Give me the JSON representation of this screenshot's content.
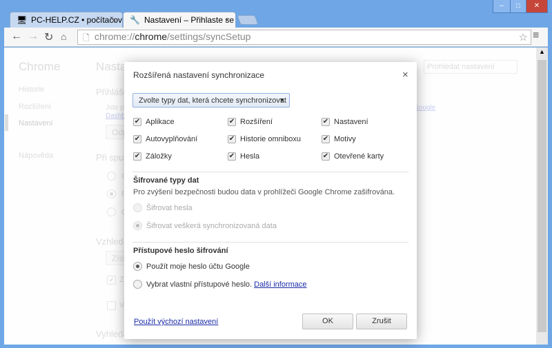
{
  "window": {
    "minimize": "–",
    "maximize": "□",
    "close": "✕"
  },
  "tabs": [
    {
      "title": "PC-HELP.CZ • počítačové",
      "icon": "computer-icon",
      "active": false
    },
    {
      "title": "Nastavení – Přihlaste se pc",
      "icon": "wrench-icon",
      "active": true
    }
  ],
  "toolbar": {
    "url_prefix": "chrome://",
    "url_host": "chrome",
    "url_path": "/settings/syncSetup"
  },
  "background": {
    "brand": "Chrome",
    "sidebar": [
      "Historie",
      "Rozšíření",
      "Nastavení",
      "Nápověda"
    ],
    "heading": "Nastavení",
    "search_placeholder": "Prohledat nastavení",
    "signin": "Přihlášení",
    "signin_text": "Jste p",
    "dashboard_link": "Dashb",
    "google_link": "Google",
    "disconnect_button": "Odp",
    "startup": "Při spuštění",
    "startup_opts": [
      "O",
      "P",
      "O"
    ],
    "appearance": "Vzhled",
    "themes_button": "Získ",
    "show_home": "Z",
    "show_bookmarks": "V",
    "search": "Vyhledá"
  },
  "dialog": {
    "title": "Rozšířená nastavení synchronizace",
    "close": "×",
    "dropdown": "Zvolte typy dat, která chcete synchronizovat",
    "datatypes": [
      {
        "label": "Aplikace",
        "checked": true
      },
      {
        "label": "Rozšíření",
        "checked": true
      },
      {
        "label": "Nastavení",
        "checked": true
      },
      {
        "label": "Autovyplňování",
        "checked": true
      },
      {
        "label": "Historie omniboxu",
        "checked": true
      },
      {
        "label": "Motivy",
        "checked": true
      },
      {
        "label": "Záložky",
        "checked": true
      },
      {
        "label": "Hesla",
        "checked": true
      },
      {
        "label": "Otevřené karty",
        "checked": true
      }
    ],
    "encrypted_heading": "Šifrované typy dat",
    "encrypted_desc": "Pro zvýšení bezpečnosti budou data v prohlížeči Google Chrome zašifrována.",
    "encrypt_passwords": "Šifrovat hesla",
    "encrypt_all": "Šifrovat veškerá synchronizovaná data",
    "passphrase_heading": "Přístupové heslo šifrování",
    "use_google": "Použít moje heslo účtu Google",
    "custom_pass": "Vybrat vlastní přístupové heslo.",
    "learn_more": "Další informace",
    "defaults_link": "Použít výchozí nastavení",
    "ok": "OK",
    "cancel": "Zrušit"
  }
}
